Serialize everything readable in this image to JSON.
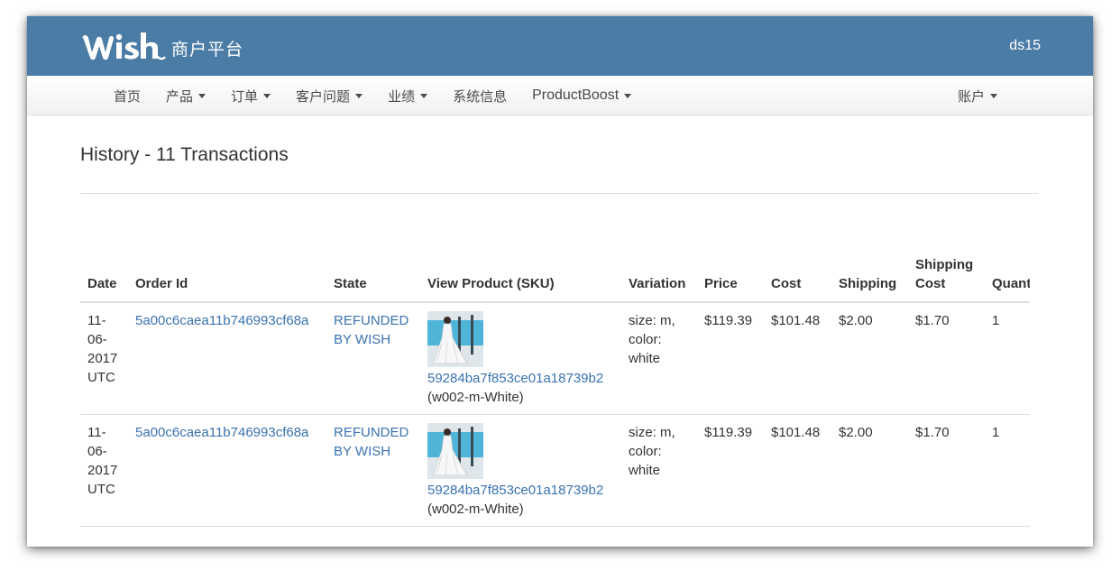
{
  "header": {
    "logo_text": "wish",
    "platform_name": "商户平台",
    "user": "ds15",
    "colors": {
      "topbar": "#4a7ca6",
      "link": "#3a73b1"
    }
  },
  "nav": {
    "items": [
      {
        "label": "首页",
        "has_caret": false
      },
      {
        "label": "产品",
        "has_caret": true
      },
      {
        "label": "订单",
        "has_caret": true
      },
      {
        "label": "客户问题",
        "has_caret": true
      },
      {
        "label": "业绩",
        "has_caret": true
      },
      {
        "label": "系统信息",
        "has_caret": false
      },
      {
        "label": "ProductBoost",
        "has_caret": true
      }
    ],
    "account": {
      "label": "账户",
      "has_caret": true
    }
  },
  "page": {
    "title": "History - 11 Transactions"
  },
  "table": {
    "columns": [
      "Date",
      "Order Id",
      "State",
      "View Product (SKU)",
      "Variation",
      "Price",
      "Cost",
      "Shipping",
      "Shipping Cost",
      "Quantity"
    ],
    "rows": [
      {
        "date": "11-06-2017 UTC",
        "order_id": "5a00c6caea11b746993cf68a",
        "state": "REFUNDED BY WISH",
        "product_id": "59284ba7f853ce01a18739b2",
        "sku": "(w002-m-White)",
        "variation": "size: m, color: white",
        "price": "$119.39",
        "cost": "$101.48",
        "shipping": "$2.00",
        "shipping_cost": "$1.70",
        "quantity": "1"
      },
      {
        "date": "11-06-2017 UTC",
        "order_id": "5a00c6caea11b746993cf68a",
        "state": "REFUNDED BY WISH",
        "product_id": "59284ba7f853ce01a18739b2",
        "sku": "(w002-m-White)",
        "variation": "size: m, color: white",
        "price": "$119.39",
        "cost": "$101.48",
        "shipping": "$2.00",
        "shipping_cost": "$1.70",
        "quantity": "1"
      }
    ]
  }
}
